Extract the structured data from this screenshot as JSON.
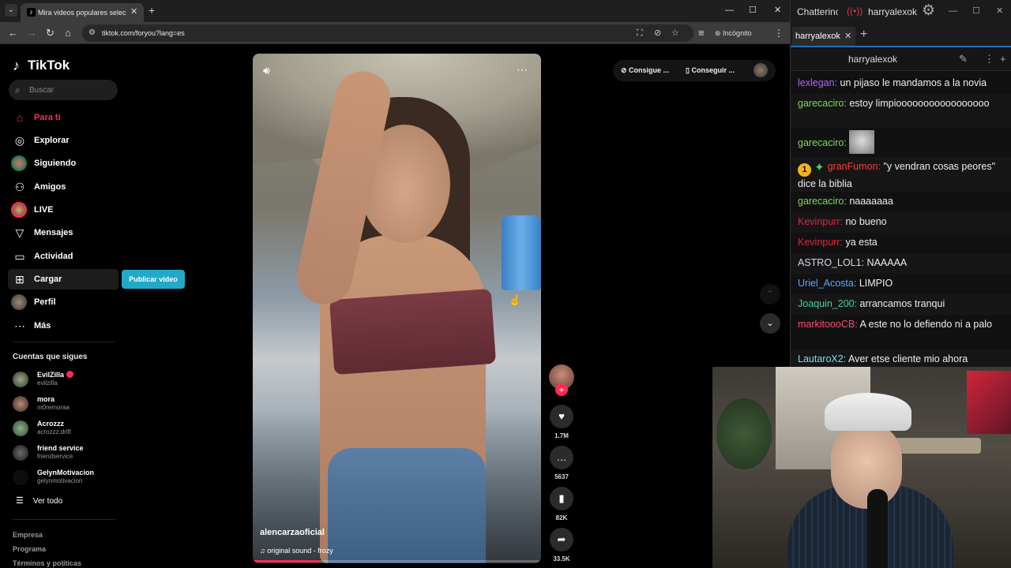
{
  "browser": {
    "tab_title": "Mira videos populares seleccion",
    "url": "tiktok.com/foryou?lang=es",
    "incognito_label": "Incógnito"
  },
  "tiktok": {
    "logo": "TikTok",
    "search_placeholder": "Buscar",
    "nav": [
      {
        "label": "Para ti",
        "icon": "home-icon",
        "active": true
      },
      {
        "label": "Explorar",
        "icon": "compass-icon"
      },
      {
        "label": "Siguiendo",
        "icon": "following-avatar"
      },
      {
        "label": "Amigos",
        "icon": "friends-icon"
      },
      {
        "label": "LIVE",
        "icon": "live-avatar"
      },
      {
        "label": "Mensajes",
        "icon": "messages-icon"
      },
      {
        "label": "Actividad",
        "icon": "activity-icon"
      },
      {
        "label": "Cargar",
        "icon": "upload-icon"
      },
      {
        "label": "Perfil",
        "icon": "profile-avatar"
      },
      {
        "label": "Más",
        "icon": "more-icon"
      }
    ],
    "publish_label": "Publicar video",
    "following_heading": "Cuentas que sigues",
    "following": [
      {
        "name": "EvilZilla",
        "user": "evilzilla",
        "live": true
      },
      {
        "name": "mora",
        "user": "m0remoraa"
      },
      {
        "name": "Acrozzz",
        "user": "acrozzz.drift"
      },
      {
        "name": "friend service",
        "user": "friendservice"
      },
      {
        "name": "GelynMotivacion",
        "user": "gelynmotivacion"
      }
    ],
    "see_all": "Ver todo",
    "footer": [
      "Empresa",
      "Programa",
      "Términos y políticas"
    ],
    "video": {
      "author": "alencarzaoficial",
      "sound": "original sound - frozy",
      "progress": 0.23
    },
    "actions": {
      "likes": "1.7M",
      "comments": "5637",
      "saves": "82K",
      "shares": "33.5K"
    },
    "top_buttons": [
      "Consigue ...",
      "Conseguir ..."
    ]
  },
  "chatterino": {
    "app": "Chatterino",
    "user": "harryalexok",
    "tab": "harryalexok",
    "channel": "harryalexok",
    "messages": [
      {
        "user": "lexlegan:",
        "color": "#b266ff",
        "text": " un pijaso le mandamos a la novia"
      },
      {
        "user": "garecaciro:",
        "color": "#7ad95a",
        "text": " estoy limpiooooooooooooooooo"
      },
      {
        "user": "garecaciro:",
        "color": "#7ad95a",
        "text": "",
        "emote": true
      },
      {
        "user": "granFumon:",
        "color": "#ff3b3b",
        "text": " \"y vendran cosas peores\" dice la biblia",
        "badges": true
      },
      {
        "user": "garecaciro:",
        "color": "#7ad95a",
        "text": " naaaaaaa"
      },
      {
        "user": "Kevinpurr:",
        "color": "#e0263c",
        "text": " no bueno"
      },
      {
        "user": "Kevinpurr:",
        "color": "#e0263c",
        "text": " ya esta"
      },
      {
        "user": "ASTRO_LOL1:",
        "color": "#cfd8e8",
        "text": " NAAAAA"
      },
      {
        "user": "Uriel_Acosta:",
        "color": "#5aa8ff",
        "text": " LIMPIO"
      },
      {
        "user": "Joaquin_200:",
        "color": "#40d0a0",
        "text": " arrancamos tranqui"
      },
      {
        "user": "markitoooCB:",
        "color": "#ff4a6e",
        "text": " A este no lo defiendo ni a palo"
      },
      {
        "user": "LautaroX2:",
        "color": "#6fe0ff",
        "text": " Aver etse cliente mio ahora"
      }
    ]
  }
}
